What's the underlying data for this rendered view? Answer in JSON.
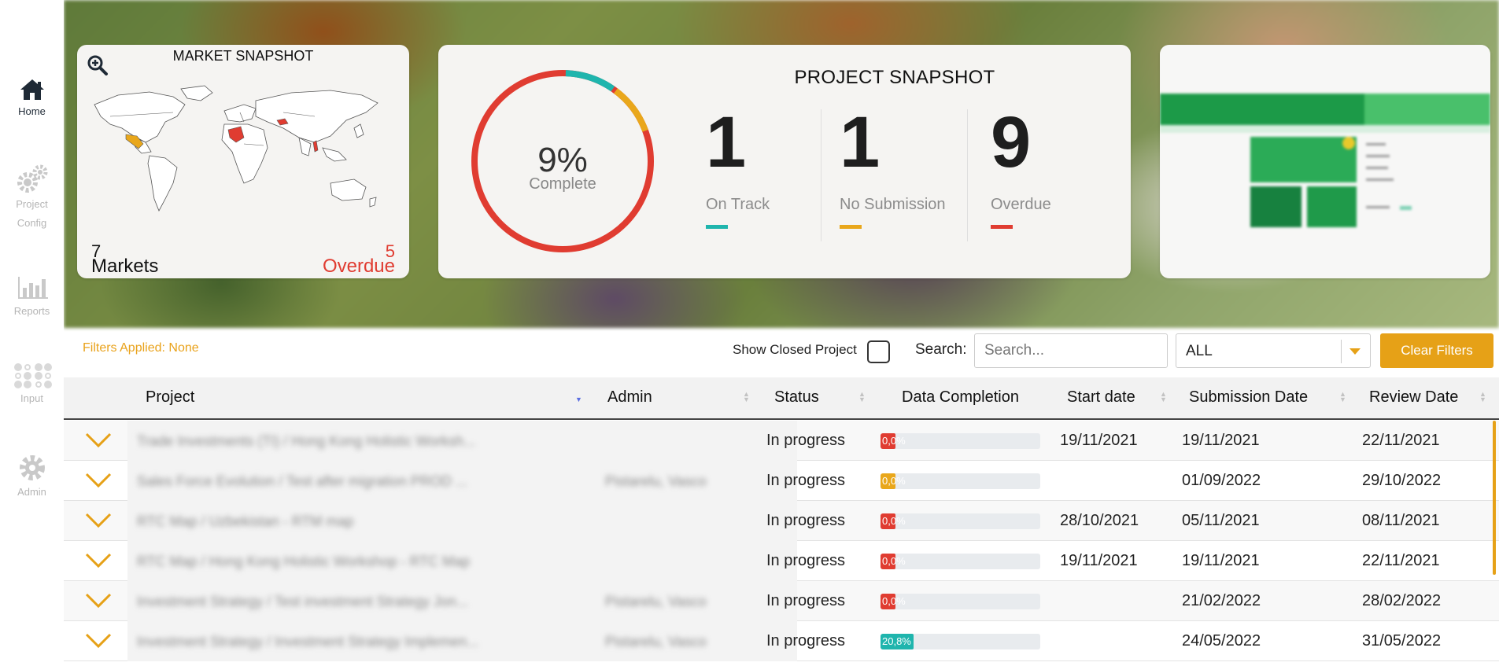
{
  "sidebar": {
    "items": [
      {
        "label": "Home",
        "icon": "home-icon",
        "active": true
      },
      {
        "label": "Project Config",
        "icon": "gears-icon",
        "active": false
      },
      {
        "label": "Reports",
        "icon": "bar-chart-icon",
        "active": false
      },
      {
        "label": "Input",
        "icon": "grid-dots-icon",
        "active": false
      },
      {
        "label": "Admin",
        "icon": "gear-icon",
        "active": false
      }
    ],
    "labels": {
      "home": "Home",
      "project": "Project",
      "config": "Config",
      "reports": "Reports",
      "input": "Input",
      "admin": "Admin"
    }
  },
  "market_snapshot": {
    "title": "MARKET SNAPSHOT",
    "markets_count": "7",
    "markets_label": "Markets",
    "overdue_count": "5",
    "overdue_label": "Overdue"
  },
  "project_snapshot": {
    "title": "PROJECT SNAPSHOT",
    "complete_pct": "9%",
    "complete_label": "Complete",
    "complete_value": 9,
    "stats": [
      {
        "value": "1",
        "label": "On Track",
        "color": "#1fb5ad"
      },
      {
        "value": "1",
        "label": "No Submission",
        "color": "#e9a71b"
      },
      {
        "value": "9",
        "label": "Overdue",
        "color": "#e03c31"
      }
    ]
  },
  "filters": {
    "applied_label": "Filters Applied: None",
    "show_closed_label": "Show Closed Project",
    "search_label": "Search:",
    "search_placeholder": "Search...",
    "select_value": "ALL",
    "clear_label": "Clear Filters"
  },
  "table": {
    "columns": {
      "project": "Project",
      "admin": "Admin",
      "status": "Status",
      "data_completion": "Data Completion",
      "start_date": "Start date",
      "submission_date": "Submission Date",
      "review_date": "Review Date"
    },
    "rows": [
      {
        "project": "Trade Investments (TI) / Hong Kong Holistic Worksh...",
        "admin": "",
        "status": "In progress",
        "completion": "0,0%",
        "completion_value": 0,
        "completion_color": "#e03c31",
        "start": "19/11/2021",
        "submission": "19/11/2021",
        "review": "22/11/2021"
      },
      {
        "project": "Sales Force Evolution / Test after migration PROD ...",
        "admin": "Pistarelu, Vasco",
        "status": "In progress",
        "completion": "0,0%",
        "completion_value": 0,
        "completion_color": "#e9a71b",
        "start": "",
        "submission": "01/09/2022",
        "review": "29/10/2022"
      },
      {
        "project": "RTC Map / Uzbekistan - RTM map",
        "admin": "",
        "status": "In progress",
        "completion": "0,0%",
        "completion_value": 0,
        "completion_color": "#e03c31",
        "start": "28/10/2021",
        "submission": "05/11/2021",
        "review": "08/11/2021"
      },
      {
        "project": "RTC Map / Hong Kong Holistic Workshop - RTC Map",
        "admin": "",
        "status": "In progress",
        "completion": "0,0%",
        "completion_value": 0,
        "completion_color": "#e03c31",
        "start": "19/11/2021",
        "submission": "19/11/2021",
        "review": "22/11/2021"
      },
      {
        "project": "Investment Strategy / Test investment Strategy Jon...",
        "admin": "Pistarelu, Vasco",
        "status": "In progress",
        "completion": "0,0%",
        "completion_value": 0,
        "completion_color": "#e03c31",
        "start": "",
        "submission": "21/02/2022",
        "review": "28/02/2022"
      },
      {
        "project": "Investment Strategy / Investment Strategy Implemen...",
        "admin": "Pistarelu, Vasco",
        "status": "In progress",
        "completion": "20,8%",
        "completion_value": 20.8,
        "completion_color": "#1fb5ad",
        "start": "",
        "submission": "24/05/2022",
        "review": "31/05/2022"
      }
    ]
  },
  "colors": {
    "accent": "#e6a117",
    "red": "#e03c31",
    "teal": "#1fb5ad",
    "yellow": "#e9a71b"
  }
}
